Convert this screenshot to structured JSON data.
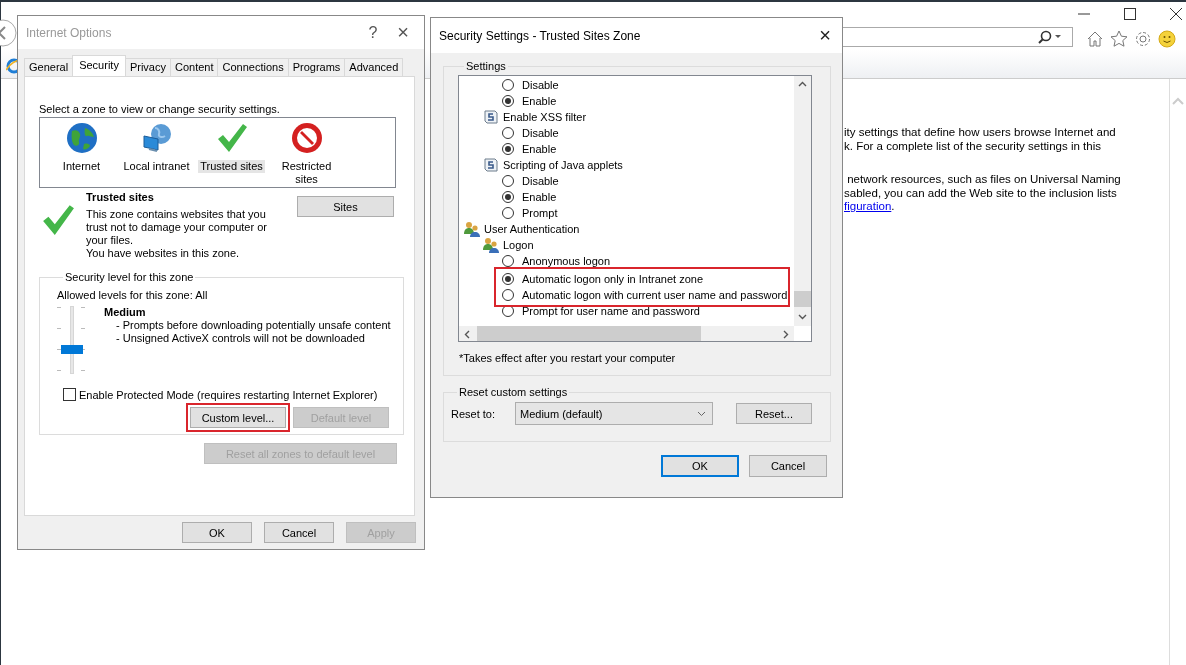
{
  "browser": {
    "content": {
      "paragraphs": [
        {
          "lines": [
            {
              "text": "ity settings that define how users browse Internet and"
            },
            {
              "text": "k. For a complete list of the security settings in this"
            }
          ]
        },
        {
          "lines": [
            {
              "text": " network resources, such as files on Universal Naming"
            },
            {
              "text": "sabled, you can add the Web site to the inclusion lists"
            },
            {
              "link": "figuration",
              "text": "."
            }
          ]
        }
      ]
    }
  },
  "internet_options": {
    "title": "Internet Options",
    "help": "?",
    "close": "×",
    "tabs": [
      {
        "label": "General",
        "selected": false
      },
      {
        "label": "Security",
        "selected": true
      },
      {
        "label": "Privacy",
        "selected": false
      },
      {
        "label": "Content",
        "selected": false
      },
      {
        "label": "Connections",
        "selected": false
      },
      {
        "label": "Programs",
        "selected": false
      },
      {
        "label": "Advanced",
        "selected": false
      }
    ],
    "zone_prompt": "Select a zone to view or change security settings.",
    "zones": [
      {
        "label": "Internet",
        "kind": "globe",
        "selected": false
      },
      {
        "label": "Local intranet",
        "kind": "network",
        "selected": false
      },
      {
        "label": "Trusted sites",
        "kind": "check",
        "selected": true
      },
      {
        "label": "Restricted sites",
        "kind": "blocked",
        "selected": false
      }
    ],
    "zone_info": {
      "kind": "check",
      "title": "Trusted sites",
      "description": "This zone contains websites that you trust not to damage your computer or your files.",
      "note": "You have websites in this zone.",
      "button": "Sites"
    },
    "security_level": {
      "legend": "Security level for this zone",
      "allowed": "Allowed levels for this zone: All",
      "level": 0.33,
      "name": "Medium",
      "bullets": [
        "- Prompts before downloading potentially unsafe content",
        "- Unsigned ActiveX controls will not be downloaded"
      ],
      "protected_mode": {
        "label": "Enable Protected Mode (requires restarting Internet Explorer)",
        "checked": false
      },
      "buttons": [
        {
          "label": "Custom level...",
          "disabled": false,
          "highlighted": true
        },
        {
          "label": "Default level",
          "disabled": true,
          "highlighted": false
        }
      ]
    },
    "reset_all": {
      "label": "Reset all zones to default level",
      "disabled": true
    },
    "buttons": [
      {
        "label": "OK",
        "disabled": false
      },
      {
        "label": "Cancel",
        "disabled": false
      },
      {
        "label": "Apply",
        "disabled": true
      }
    ]
  },
  "security_settings": {
    "title": "Security Settings - Trusted Sites Zone",
    "close": "×",
    "settings_legend": "Settings",
    "tree": [
      {
        "children": [
          {
            "children": [
              {
                "kind": "option",
                "label": "Disable",
                "selected": false
              },
              {
                "kind": "option",
                "label": "Enable",
                "selected": true
              }
            ]
          },
          {
            "kind": "setting",
            "label": "Enable XSS filter",
            "children": [
              {
                "kind": "option",
                "label": "Disable",
                "selected": false
              },
              {
                "kind": "option",
                "label": "Enable",
                "selected": true
              }
            ]
          },
          {
            "kind": "setting",
            "label": "Scripting of Java applets",
            "children": [
              {
                "kind": "option",
                "label": "Disable",
                "selected": false
              },
              {
                "kind": "option",
                "label": "Enable",
                "selected": true
              },
              {
                "kind": "option",
                "label": "Prompt",
                "selected": false
              }
            ]
          }
        ]
      },
      {
        "kind": "category",
        "label": "User Authentication",
        "children": [
          {
            "kind": "category",
            "label": "Logon",
            "children": [
              {
                "kind": "option",
                "label": "Anonymous logon",
                "selected": false,
                "highlighted": false
              },
              {
                "kind": "option",
                "label": "Automatic logon only in Intranet zone",
                "selected": true,
                "highlighted": true
              },
              {
                "kind": "option",
                "label": "Automatic logon with current user name and password",
                "selected": false,
                "highlighted": true
              },
              {
                "kind": "option",
                "label": "Prompt for user name and password",
                "selected": false,
                "highlighted": false
              }
            ]
          }
        ]
      }
    ],
    "note": "*Takes effect after you restart your computer",
    "reset": {
      "legend": "Reset custom settings",
      "label": "Reset to:",
      "value": "Medium (default)",
      "button": "Reset..."
    },
    "buttons": [
      {
        "label": "OK",
        "focused": true
      },
      {
        "label": "Cancel",
        "focused": false
      }
    ]
  }
}
